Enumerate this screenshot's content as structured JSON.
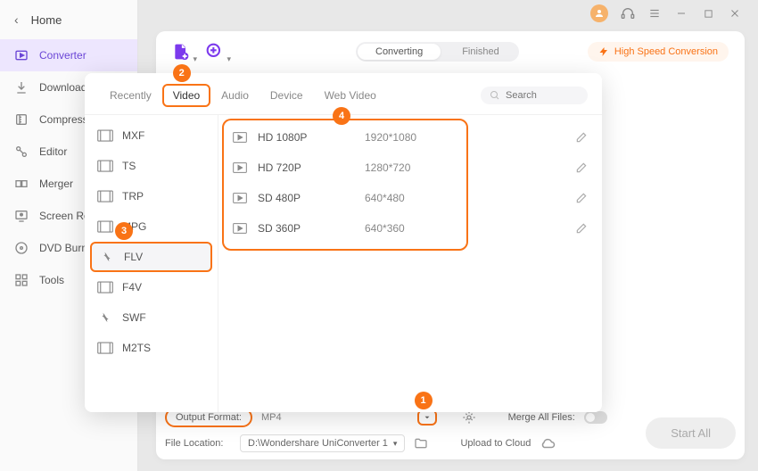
{
  "titlebar": {
    "icons": [
      "avatar",
      "headset",
      "menu",
      "minimize",
      "maximize",
      "close"
    ]
  },
  "sidebar": {
    "home": "Home",
    "items": [
      {
        "label": "Converter",
        "icon": "converter-icon",
        "active": true
      },
      {
        "label": "Downloader",
        "icon": "download-icon"
      },
      {
        "label": "Compressor",
        "icon": "compressor-icon"
      },
      {
        "label": "Editor",
        "icon": "editor-icon"
      },
      {
        "label": "Merger",
        "icon": "merger-icon"
      },
      {
        "label": "Screen Recorder",
        "icon": "screen-recorder-icon"
      },
      {
        "label": "DVD Burner",
        "icon": "dvd-icon"
      },
      {
        "label": "Tools",
        "icon": "tools-icon"
      }
    ]
  },
  "toolbar": {
    "tabs": {
      "converting": "Converting",
      "finished": "Finished",
      "active": "converting"
    },
    "highspeed": "High Speed Conversion"
  },
  "panel": {
    "tabs": [
      "Recently",
      "Video",
      "Audio",
      "Device",
      "Web Video"
    ],
    "active_tab": "Video",
    "search_placeholder": "Search",
    "categories": [
      {
        "label": "MXF"
      },
      {
        "label": "TS"
      },
      {
        "label": "TRP"
      },
      {
        "label": "MPG"
      },
      {
        "label": "FLV",
        "selected": true
      },
      {
        "label": "F4V"
      },
      {
        "label": "SWF"
      },
      {
        "label": "M2TS"
      }
    ],
    "presets": [
      {
        "name": "HD 1080P",
        "res": "1920*1080"
      },
      {
        "name": "HD 720P",
        "res": "1280*720"
      },
      {
        "name": "SD 480P",
        "res": "640*480"
      },
      {
        "name": "SD 360P",
        "res": "640*360"
      }
    ]
  },
  "bottom": {
    "output_format_label": "Output Format:",
    "output_format_value": "MP4",
    "file_location_label": "File Location:",
    "file_location_value": "D:\\Wondershare UniConverter 1",
    "merge_label": "Merge All Files:",
    "upload_label": "Upload to Cloud",
    "start_all": "Start All"
  },
  "badges": {
    "b1": "1",
    "b2": "2",
    "b3": "3",
    "b4": "4"
  },
  "colors": {
    "accent": "#f97316",
    "primary": "#6b46d6"
  }
}
